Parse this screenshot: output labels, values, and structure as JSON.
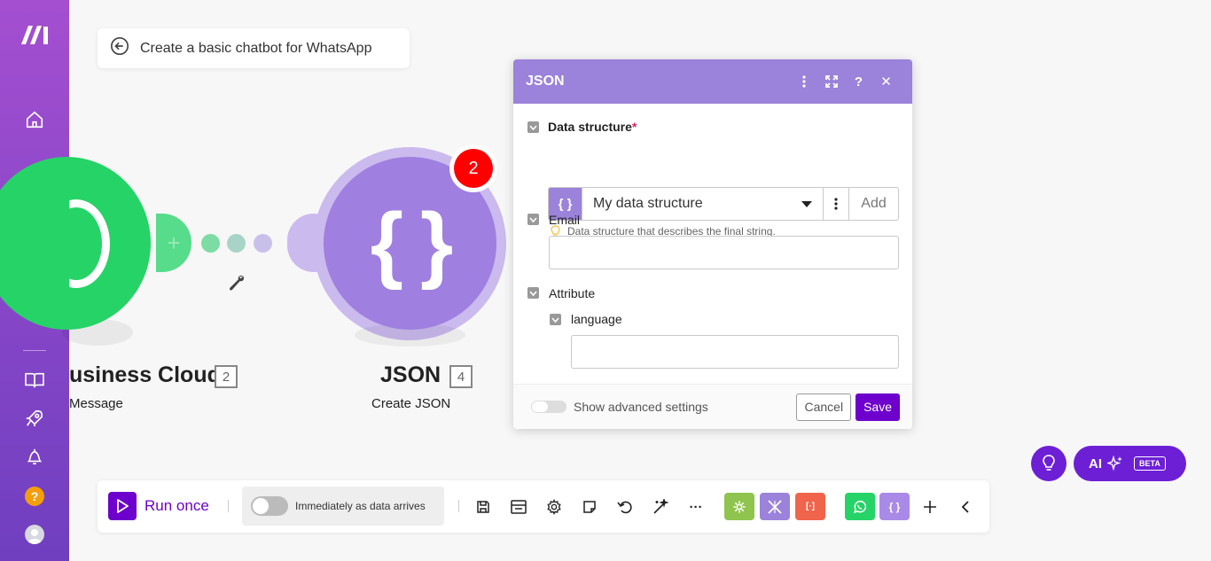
{
  "scenario": {
    "title": "Create a basic chatbot for WhatsApp"
  },
  "nodes": {
    "whatsapp": {
      "title": "usiness Cloud",
      "number": "2",
      "subtitle": "Message"
    },
    "json": {
      "title": "JSON",
      "number": "4",
      "subtitle": "Create JSON",
      "badge": "2",
      "glyph": "{ }"
    }
  },
  "panel": {
    "title": "JSON",
    "data_structure_label": "Data structure",
    "required_mark": "*",
    "data_structure_value": "My data structure",
    "add_label": "Add",
    "hint": "Data structure that describes the final string.",
    "email_label": "Email",
    "email_value": "",
    "attribute_label": "Attribute",
    "language_label": "language",
    "language_value": "",
    "advanced_label": "Show advanced settings",
    "cancel_label": "Cancel",
    "save_label": "Save"
  },
  "ai": {
    "label": "AI",
    "beta": "BETA"
  },
  "toolbar": {
    "run_once": "Run once",
    "schedule": "Immediately as data arrives",
    "module_glyph": "{ }",
    "more": "···"
  },
  "colors": {
    "sidebar_top": "#a44fd0",
    "sidebar_bottom": "#6f3fc0",
    "whatsapp_green": "#25d366",
    "json_purple": "#9f7fe0",
    "panel_header": "#9b82da",
    "accent": "#6d00cc",
    "badge_red": "#ff0000"
  }
}
